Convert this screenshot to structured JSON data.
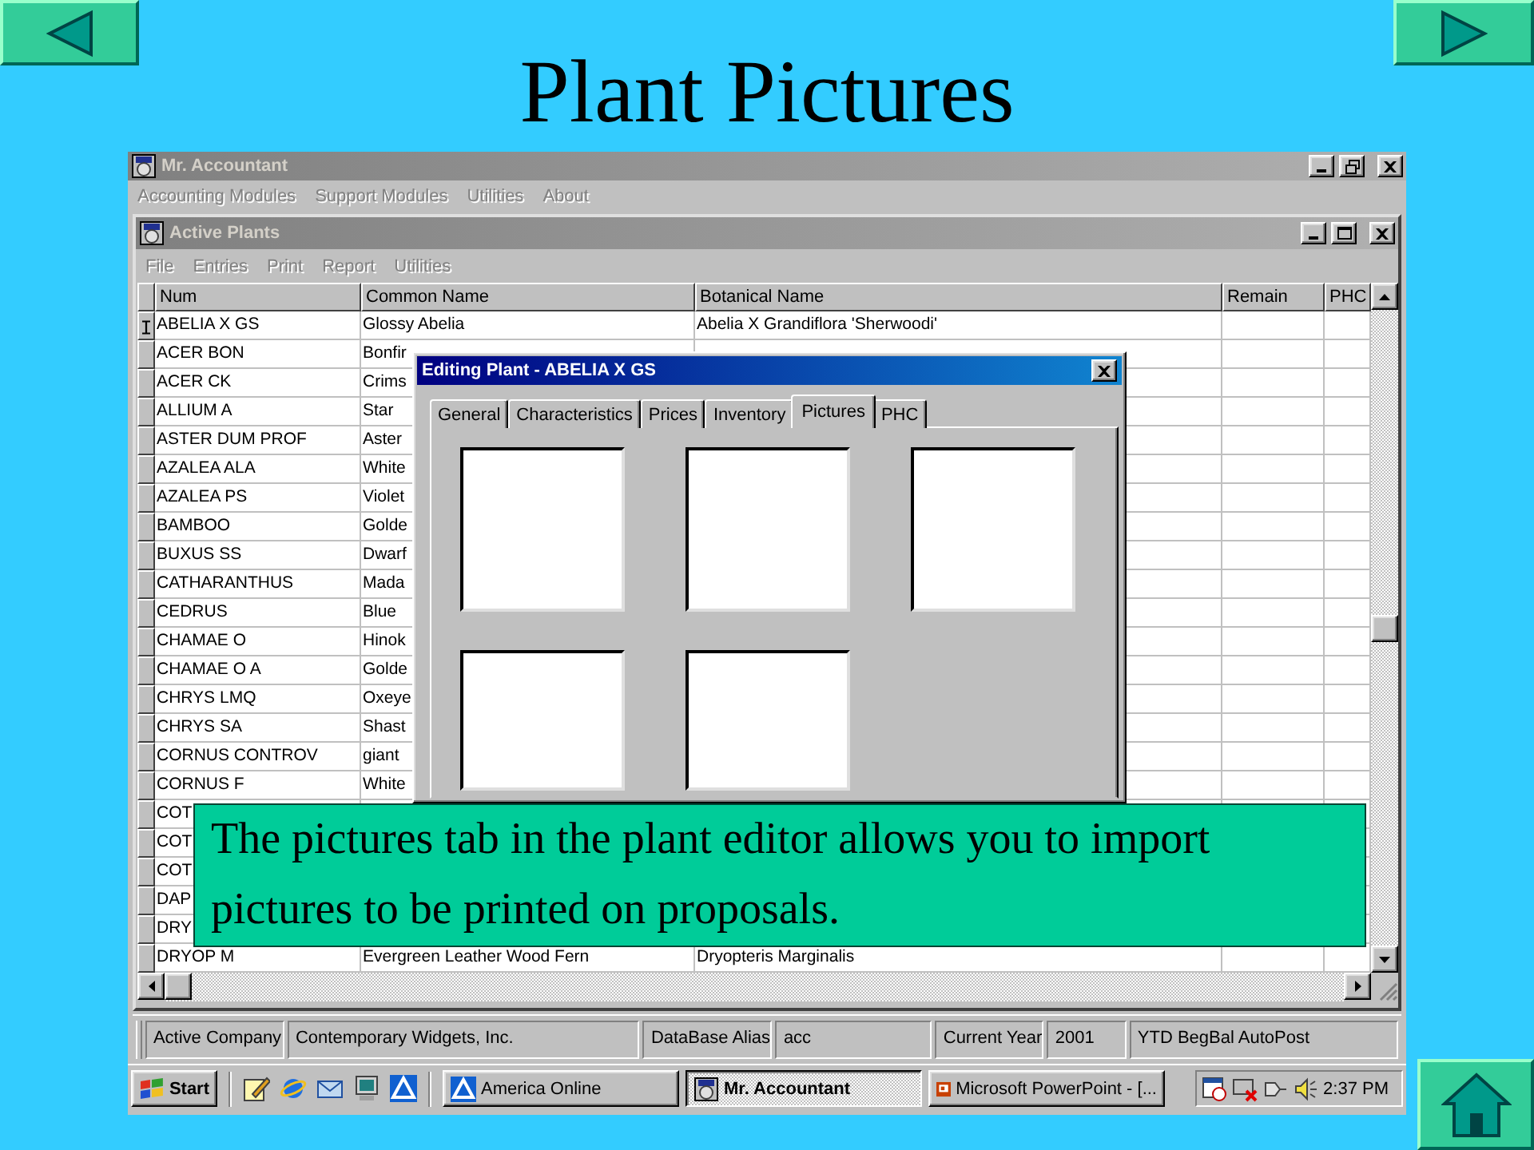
{
  "slide": {
    "title": "Plant Pictures"
  },
  "main_window": {
    "title": "Mr. Accountant",
    "menu": [
      {
        "label": "Accounting Modules",
        "disabled": true
      },
      {
        "label": "Support Modules",
        "disabled": true
      },
      {
        "label": "Utilities",
        "disabled": true
      },
      {
        "label": "About",
        "disabled": true
      }
    ]
  },
  "child_window": {
    "title": "Active Plants",
    "menu": [
      {
        "label": "File",
        "disabled": true
      },
      {
        "label": "Entries",
        "disabled": true
      },
      {
        "label": "Print",
        "disabled": true
      },
      {
        "label": "Report",
        "disabled": true
      },
      {
        "label": "Utilities",
        "disabled": true
      }
    ],
    "table": {
      "columns": [
        "Num",
        "Common Name",
        "Botanical Name",
        "Remain",
        "PHC"
      ],
      "rows": [
        {
          "num": "ABELIA X GS",
          "common_name": "Glossy Abelia",
          "botanical_name": "Abelia X Grandiflora 'Sherwoodi'",
          "selected": true
        },
        {
          "num": "ACER BON",
          "common_name": "Bonfir",
          "selected": false
        },
        {
          "num": "ACER CK",
          "common_name": "Crims",
          "selected": false
        },
        {
          "num": "ALLIUM A",
          "common_name": "Star",
          "selected": false
        },
        {
          "num": "ASTER DUM PROF",
          "common_name": "Aster",
          "selected": false
        },
        {
          "num": "AZALEA ALA",
          "common_name": "White",
          "selected": false
        },
        {
          "num": "AZALEA PS",
          "common_name": "Violet",
          "selected": false
        },
        {
          "num": "BAMBOO",
          "common_name": "Golde",
          "selected": false
        },
        {
          "num": "BUXUS SS",
          "common_name": "Dwarf",
          "selected": false
        },
        {
          "num": "CATHARANTHUS",
          "common_name": "Mada",
          "selected": false
        },
        {
          "num": "CEDRUS",
          "common_name": "Blue",
          "selected": false
        },
        {
          "num": "CHAMAE O",
          "common_name": "Hinok",
          "selected": false
        },
        {
          "num": "CHAMAE O A",
          "common_name": "Golde",
          "selected": false
        },
        {
          "num": "CHRYS LMQ",
          "common_name": "Oxeye",
          "selected": false
        },
        {
          "num": "CHRYS SA",
          "common_name": "Shast",
          "selected": false
        },
        {
          "num": "CORNUS CONTROV",
          "common_name": "giant",
          "selected": false
        },
        {
          "num": "CORNUS F",
          "common_name": "White",
          "selected": false
        },
        {
          "num": "COT",
          "selected": false
        },
        {
          "num": "COT",
          "selected": false
        },
        {
          "num": "COT",
          "selected": false
        },
        {
          "num": "DAP",
          "selected": false
        },
        {
          "num": "DRY",
          "selected": false
        },
        {
          "num": "DRYOP M",
          "common_name": "Evergreen Leather Wood Fern",
          "botanical_name": "Dryopteris Marginalis",
          "selected": false
        }
      ]
    }
  },
  "dialog": {
    "title": "Editing Plant - ABELIA X GS",
    "tabs": [
      {
        "label": "General",
        "selected": false
      },
      {
        "label": "Characteristics",
        "selected": false
      },
      {
        "label": "Prices",
        "selected": false
      },
      {
        "label": "Inventory",
        "selected": false
      },
      {
        "label": "Pictures",
        "selected": true
      },
      {
        "label": "PHC",
        "selected": false
      }
    ],
    "picture_slots": [
      {
        "filled": false
      },
      {
        "filled": false
      },
      {
        "filled": false
      },
      {
        "filled": false
      },
      {
        "filled": false
      }
    ]
  },
  "status_bar": [
    "Active Company",
    "Contemporary Widgets, Inc.",
    "DataBase Alias",
    "acc",
    "Current Year",
    "2001",
    "YTD  BegBal  AutoPost"
  ],
  "taskbar": {
    "start": "Start",
    "tasks": [
      {
        "label": "America  Online",
        "kind": "aol",
        "selected": false
      },
      {
        "label": "Mr. Accountant",
        "kind": "app",
        "selected": true
      },
      {
        "label": "Microsoft PowerPoint - [...",
        "kind": "slides",
        "selected": false
      }
    ],
    "clock": "2:37 PM"
  },
  "callout": {
    "text": "The pictures tab in the plant editor allows you to import pictures to be printed on proposals."
  }
}
